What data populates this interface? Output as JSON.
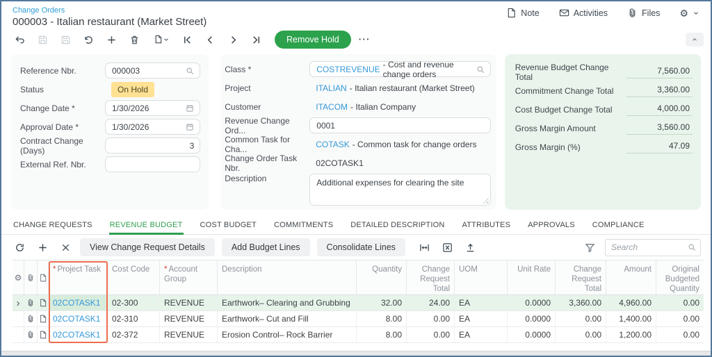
{
  "header": {
    "breadcrumb": "Change Orders",
    "title": "000003 - Italian restaurant (Market Street)",
    "actions": {
      "note": "Note",
      "activities": "Activities",
      "files": "Files"
    }
  },
  "toolbar": {
    "remove_hold": "Remove Hold"
  },
  "form": {
    "left": {
      "reference_label": "Reference Nbr.",
      "reference_value": "000003",
      "status_label": "Status",
      "status_value": "On Hold",
      "change_date_label": "Change Date *",
      "change_date_value": "1/30/2026",
      "approval_date_label": "Approval Date *",
      "approval_date_value": "1/30/2026",
      "contract_change_label": "Contract Change (Days)",
      "contract_change_value": "3",
      "external_ref_label": "External Ref. Nbr.",
      "external_ref_value": ""
    },
    "middle": {
      "class_label": "Class *",
      "class_code": "COSTREVENUE",
      "class_desc": "- Cost and revenue change orders",
      "project_label": "Project",
      "project_code": "ITALIAN",
      "project_desc": "- Italian restaurant (Market Street)",
      "customer_label": "Customer",
      "customer_code": "ITACOM",
      "customer_desc": "- Italian Company",
      "revenue_change_label": "Revenue Change Ord...",
      "revenue_change_value": "0001",
      "common_task_label": "Common Task for Cha...",
      "common_task_code": "COTASK",
      "common_task_desc": "- Common task for change orders",
      "change_order_task_label": "Change Order Task Nbr.",
      "change_order_task_value": "02COTASK1",
      "description_label": "Description",
      "description_value": "Additional expenses for clearing the site"
    },
    "summary": {
      "items": [
        {
          "label": "Revenue Budget Change Total",
          "value": "7,560.00"
        },
        {
          "label": "Commitment Change Total",
          "value": "3,360.00"
        },
        {
          "label": "Cost Budget Change Total",
          "value": "4,000.00"
        },
        {
          "label": "Gross Margin Amount",
          "value": "3,560.00"
        },
        {
          "label": "Gross Margin (%)",
          "value": "47.09"
        }
      ]
    }
  },
  "tabs": [
    {
      "label": "CHANGE REQUESTS",
      "active": false
    },
    {
      "label": "REVENUE BUDGET",
      "active": true
    },
    {
      "label": "COST BUDGET",
      "active": false
    },
    {
      "label": "COMMITMENTS",
      "active": false
    },
    {
      "label": "DETAILED DESCRIPTION",
      "active": false
    },
    {
      "label": "ATTRIBUTES",
      "active": false
    },
    {
      "label": "APPROVALS",
      "active": false
    },
    {
      "label": "COMPLIANCE",
      "active": false
    }
  ],
  "grid": {
    "buttons": {
      "view_change_request_details": "View Change Request Details",
      "add_budget_lines": "Add Budget Lines",
      "consolidate_lines": "Consolidate Lines"
    },
    "search_placeholder": "Search",
    "columns": {
      "project_task": "Project Task",
      "cost_code": "Cost Code",
      "account_group": "Account Group",
      "description": "Description",
      "quantity": "Quantity",
      "change_request_total_quantity": "Change Request Total Quantity",
      "uom": "UOM",
      "unit_rate": "Unit Rate",
      "change_request_total_amount": "Change Request Total Amount",
      "amount": "Amount",
      "original_budgeted_quantity": "Original Budgeted Quantity"
    },
    "rows": [
      {
        "project_task": "02COTASK1",
        "cost_code": "02-300",
        "account_group": "REVENUE",
        "description": "Earthwork– Clearing and Grubbing",
        "quantity": "32.00",
        "change_request_total_quantity": "24.00",
        "uom": "EA",
        "unit_rate": "0.0000",
        "change_request_total_amount": "3,360.00",
        "amount": "4,960.00",
        "original_budgeted_quantity": "0.00",
        "selected": true
      },
      {
        "project_task": "02COTASK1",
        "cost_code": "02-310",
        "account_group": "REVENUE",
        "description": "Earthwork– Cut and Fill",
        "quantity": "8.00",
        "change_request_total_quantity": "0.00",
        "uom": "EA",
        "unit_rate": "0.0000",
        "change_request_total_amount": "0.00",
        "amount": "1,400.00",
        "original_budgeted_quantity": "0.00",
        "selected": false
      },
      {
        "project_task": "02COTASK1",
        "cost_code": "02-372",
        "account_group": "REVENUE",
        "description": "Erosion Control– Rock Barrier",
        "quantity": "8.00",
        "change_request_total_quantity": "0.00",
        "uom": "EA",
        "unit_rate": "0.0000",
        "change_request_total_amount": "0.00",
        "amount": "1,200.00",
        "original_budgeted_quantity": "0.00",
        "selected": false
      }
    ]
  },
  "colors": {
    "accent_green": "#2ca24d",
    "active_tab_green": "#2f9e4f",
    "link_blue": "#3598d8",
    "status_badge_bg": "#ffe193",
    "summary_panel_bg": "#e9f5ec",
    "column_highlight_outline": "#ed6e4f"
  }
}
